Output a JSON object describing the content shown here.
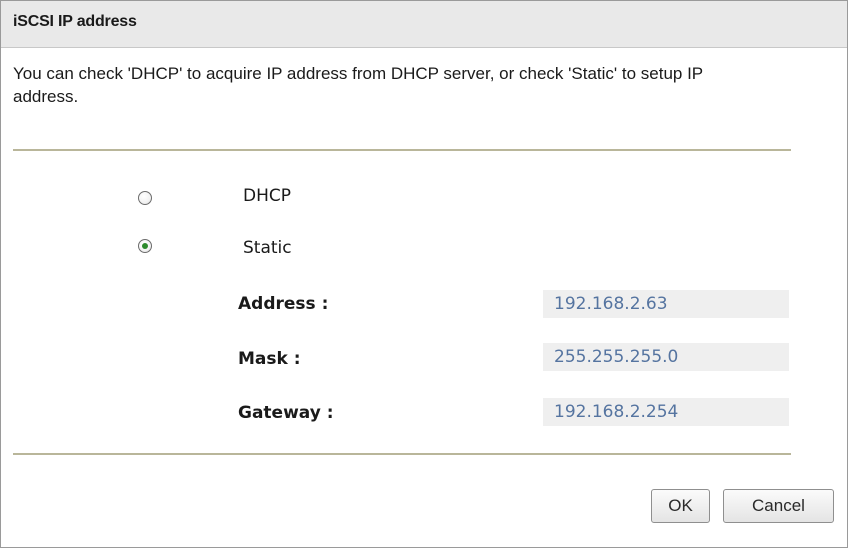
{
  "dialog": {
    "title": "iSCSI IP address",
    "description": "You can check 'DHCP' to acquire IP address from DHCP server, or check 'Static' to setup IP address."
  },
  "options": [
    {
      "label": "DHCP",
      "selected": false
    },
    {
      "label": "Static",
      "selected": true
    }
  ],
  "fields": {
    "address": {
      "label": "Address :",
      "value": "192.168.2.63"
    },
    "mask": {
      "label": "Mask :",
      "value": "255.255.255.0"
    },
    "gateway": {
      "label": "Gateway :",
      "value": "192.168.2.254"
    }
  },
  "buttons": {
    "ok": "OK",
    "cancel": "Cancel"
  },
  "colors": {
    "selected_dot": "#2c8a2c",
    "field_value_text": "#5574a0",
    "separator": "#b9b69a"
  }
}
